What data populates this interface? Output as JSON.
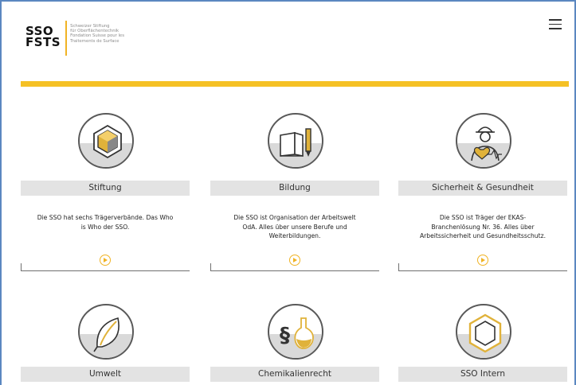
{
  "logo": {
    "mark_line1": "SSO",
    "mark_line2": "FSTS",
    "tagline": [
      "Schweizer Stiftung",
      "für Oberflächentechnik",
      "Fondation Suisse pour les",
      "Traitements de Surface"
    ]
  },
  "menu": {
    "icon": "hamburger-menu-icon"
  },
  "colors": {
    "accent": "#f5c125",
    "play": "#f0b324",
    "title_bar": "#e3e3e3",
    "border": "#5b87c0"
  },
  "cards": [
    {
      "title": "Stiftung",
      "icon": "cube-icon",
      "description": [
        "Die SSO hat sechs Trägerverbände. Das Who",
        "is Who der SSO."
      ]
    },
    {
      "title": "Bildung",
      "icon": "book-pen-icon",
      "description": [
        "Die SSO ist Organisation der Arbeitswelt",
        "OdA. Alles über unsere Berufe und",
        "Weiterbildungen."
      ]
    },
    {
      "title": "Sicherheit & Gesundheit",
      "icon": "worker-heart-icon",
      "description": [
        "Die SSO ist Träger der EKAS-",
        "Branchenlösung Nr. 36. Alles über",
        "Arbeitssicherheit und Gesundheitsschutz."
      ]
    },
    {
      "title": "Umwelt",
      "icon": "leaf-icon",
      "description": []
    },
    {
      "title": "Chemikalienrecht",
      "icon": "paragraph-flask-icon",
      "description": []
    },
    {
      "title": "SSO Intern",
      "icon": "hexagon-icon",
      "description": []
    }
  ]
}
